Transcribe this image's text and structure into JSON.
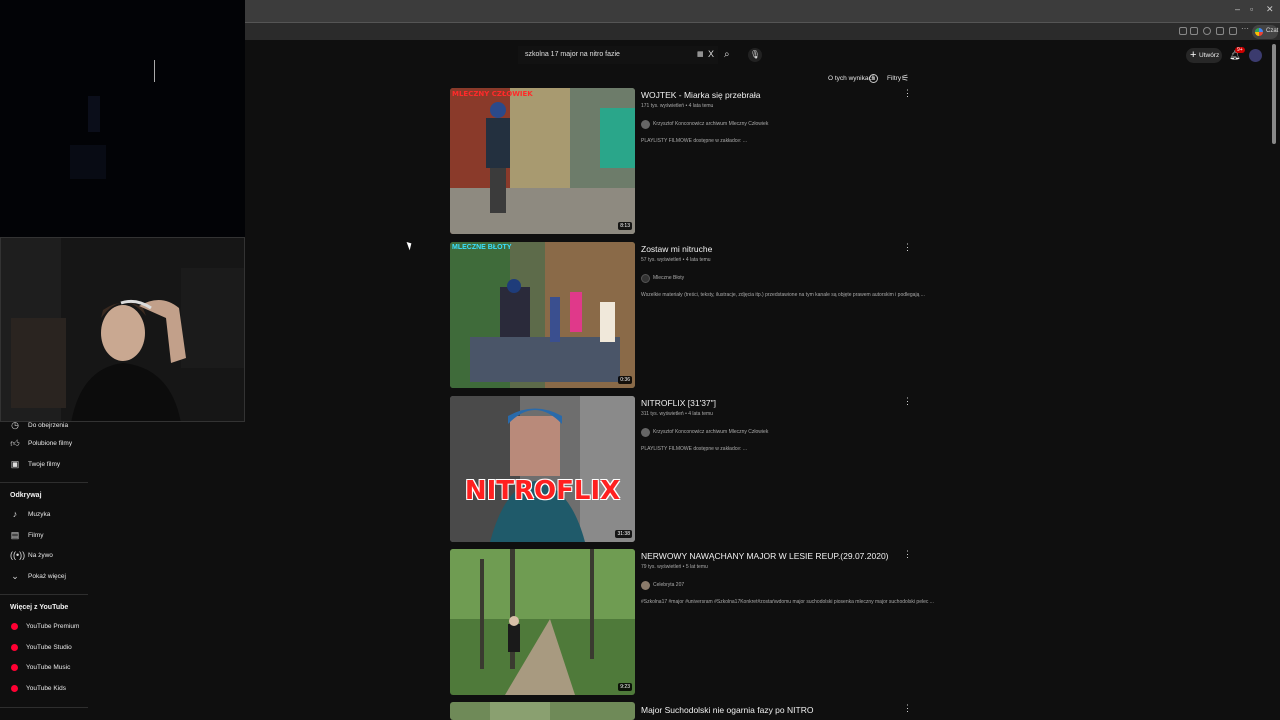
{
  "browser": {
    "window_controls": [
      "–",
      "▫",
      "✕"
    ],
    "profile_label": "Czat"
  },
  "masthead": {
    "search_query": "szkolna 17 major na nitro fazie",
    "clear_label": "X",
    "create_label": "Utwórz",
    "notifications_badge": "9+"
  },
  "filters_bar": {
    "about_results_label": "O tych wynikach",
    "filters_label": "Filtry"
  },
  "sidebar": {
    "items_top": [
      {
        "label": "Do obejrzenia",
        "icon": "clock-icon"
      },
      {
        "label": "Polubione filmy",
        "icon": "thumbs-up-icon"
      },
      {
        "label": "Twoje filmy",
        "icon": "play-square-icon"
      }
    ],
    "explore_heading": "Odkrywaj",
    "explore_items": [
      {
        "label": "Muzyka",
        "icon": "music-note-icon"
      },
      {
        "label": "Filmy",
        "icon": "clapperboard-icon"
      },
      {
        "label": "Na żywo",
        "icon": "live-icon"
      },
      {
        "label": "Pokaż więcej",
        "icon": "chevron-down-icon"
      }
    ],
    "more_heading": "Więcej z YouTube",
    "more_items": [
      {
        "label": "YouTube Premium"
      },
      {
        "label": "YouTube Studio"
      },
      {
        "label": "YouTube Music"
      },
      {
        "label": "YouTube Kids"
      }
    ]
  },
  "results": [
    {
      "title": "WOJTEK - Miarka się przebrała",
      "meta": "171 tys. wyświetleń • 4 lata temu",
      "channel": "Krzysztof Konconowicz archiwum Mleczny Człowiek",
      "description": "PLAYLISTY FILMOWE dostępne w zakładce: ...",
      "duration": "8:13",
      "thumb_caption": "MLECZNY CZŁOWIEK"
    },
    {
      "title": "Zostaw mi nitruche",
      "meta": "57 tys. wyświetleń • 4 lata temu",
      "channel": "Mleczne Błoty",
      "description": "Wszelkie materiały (treści, teksty, ilustracje, zdjęcia itp.) przedstawione na tym kanale są objęte prawem autorskim i podlegają ...",
      "duration": "0:36",
      "thumb_caption": "MLECZNE BŁOTY"
    },
    {
      "title": "NITROFLIX [31'37\"]",
      "meta": "311 tys. wyświetleń • 4 lata temu",
      "channel": "Krzysztof Konconowicz archiwum Mleczny Człowiek",
      "description": "PLAYLISTY FILMOWE dostępne w zakładce: ...",
      "duration": "31:38",
      "thumb_caption": "NITROFLIX"
    },
    {
      "title": "NERWOWY NAWĄCHANY MAJOR W LESIE REUP.(29.07.2020)",
      "meta": "79 tys. wyświetleń • 5 lat temu",
      "channel": "Celebryta 207",
      "description": "#Szkolna17 #major #universram #Szkolna17Konkret#zostańwdomu major suchodolski piosenka mleczny major suchodolski pelec ...",
      "duration": "9:23",
      "thumb_caption": ""
    },
    {
      "title": "Major Suchodolski nie ogarnia fazy po NITRO",
      "meta": "",
      "channel": "",
      "description": "",
      "duration": "",
      "thumb_caption": ""
    }
  ]
}
